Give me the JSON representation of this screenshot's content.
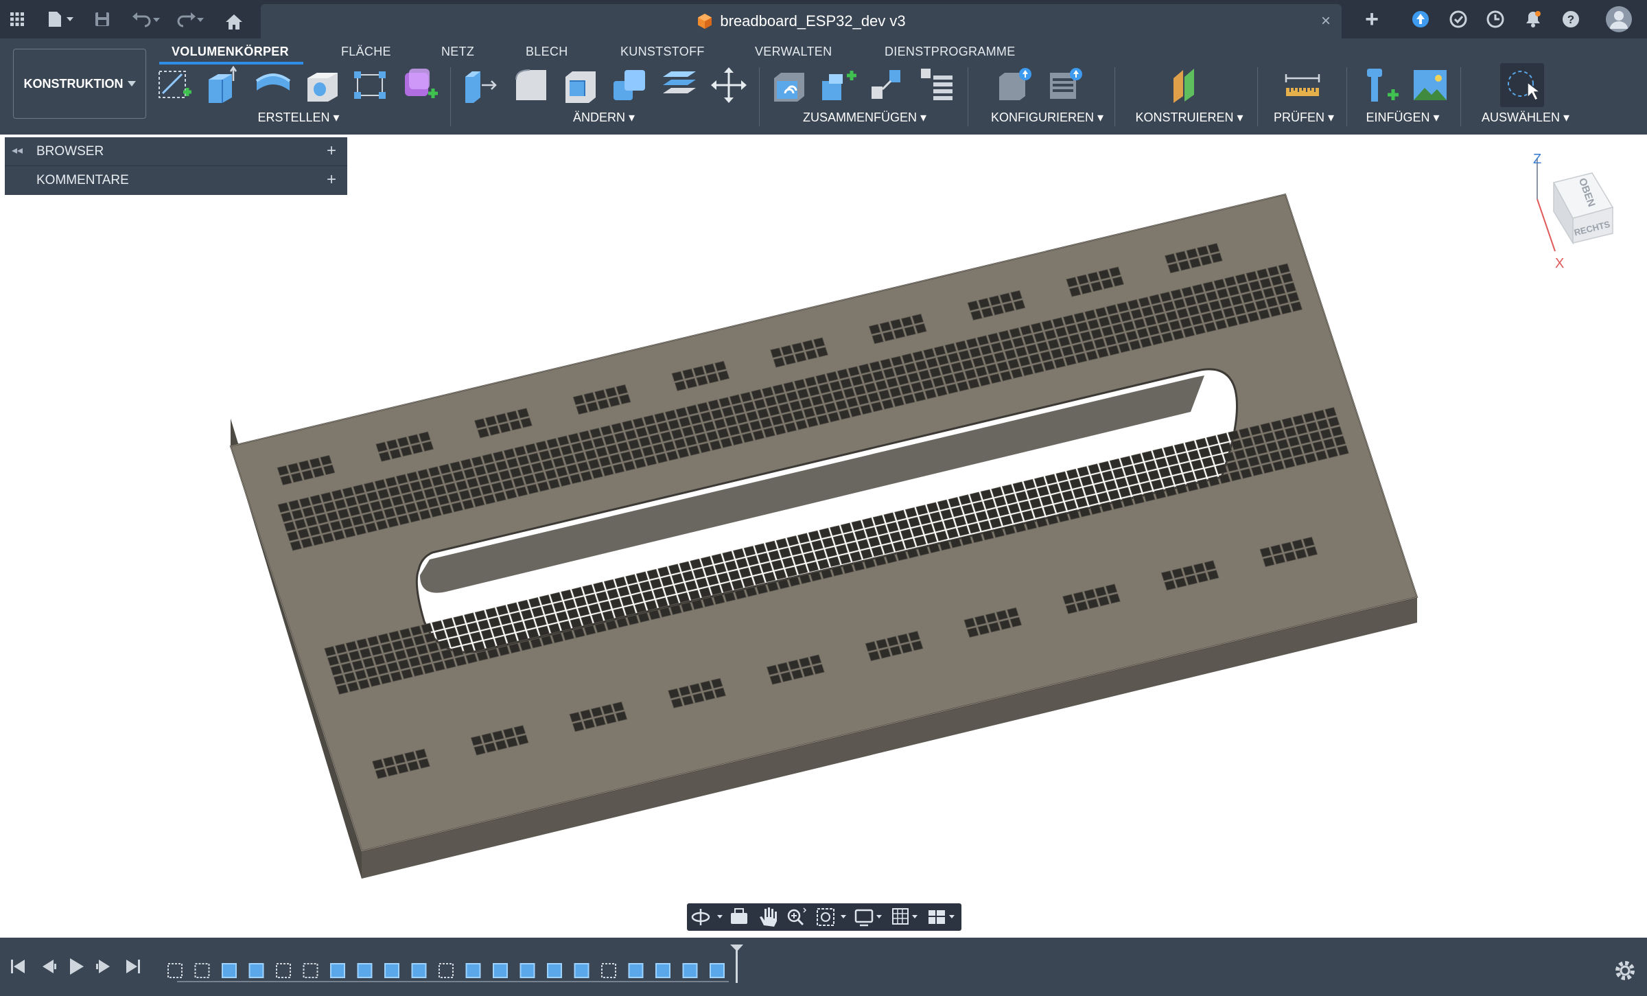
{
  "window": {
    "title": "breadboard_ESP32_dev v3",
    "close_glyph": "×",
    "new_tab_glyph": "+"
  },
  "titlebar_icons": [
    "apps-grid-icon",
    "file-menu-icon",
    "save-icon",
    "undo-icon",
    "redo-icon",
    "home-icon",
    "extensions-icon",
    "job-status-icon",
    "history-icon",
    "notifications-icon",
    "help-icon",
    "user-avatar"
  ],
  "ribbon": {
    "tabs": [
      "VOLUMENKÖRPER",
      "FLÄCHE",
      "NETZ",
      "BLECH",
      "KUNSTSTOFF",
      "VERWALTEN",
      "DIENSTPROGRAMME"
    ],
    "active_tab": "VOLUMENKÖRPER",
    "workspace": "KONSTRUKTION",
    "groups": [
      "ERSTELLEN",
      "ÄNDERN",
      "ZUSAMMENFÜGEN",
      "KONFIGURIEREN",
      "KONSTRUIEREN",
      "PRÜFEN",
      "EINFÜGEN",
      "AUSWÄHLEN"
    ]
  },
  "browser": {
    "rows": [
      {
        "label": "BROWSER",
        "action": "+"
      },
      {
        "label": "KOMMENTARE",
        "action": "+"
      }
    ]
  },
  "viewcube": {
    "top_face": "OBEN",
    "right_face": "RECHTS",
    "axis_z": "Z",
    "axis_x": "X"
  },
  "colors": {
    "chrome_dark": "#2b3440",
    "chrome": "#3a4654",
    "accent": "#2f8fe8",
    "model_top": "#7e786d",
    "model_side": "#5c5851"
  },
  "navbar_icons": [
    "orbit-icon",
    "look-at-icon",
    "pan-icon",
    "zoom-icon",
    "fit-icon",
    "display-settings-icon",
    "grid-icon",
    "viewports-icon"
  ],
  "timeline": {
    "controls": [
      "skip-start-icon",
      "step-back-icon",
      "play-icon",
      "step-forward-icon",
      "skip-end-icon"
    ],
    "feature_count": 21,
    "settings_icon": "gear-icon"
  }
}
